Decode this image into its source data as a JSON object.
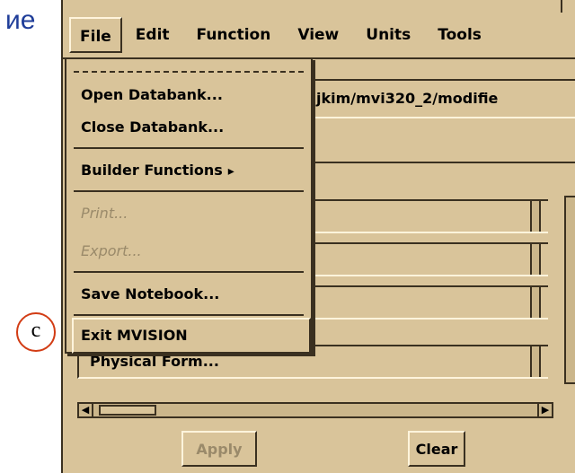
{
  "slide": {
    "text_fragment": "ие",
    "callout_label": "c"
  },
  "menubar": {
    "items": [
      {
        "label": "File",
        "active": true
      },
      {
        "label": "Edit"
      },
      {
        "label": "Function"
      },
      {
        "label": "View"
      },
      {
        "label": "Units"
      },
      {
        "label": "Tools"
      }
    ]
  },
  "path_field": {
    "value": "jkim/mvi320_2/modifie"
  },
  "file_menu": {
    "items": [
      {
        "label": "Open Databank...",
        "enabled": true
      },
      {
        "label": "Close Databank...",
        "enabled": true
      },
      {
        "label": "Builder Functions",
        "enabled": true,
        "cascade_icon": "cascade-arrow-icon"
      },
      {
        "label": "Print...",
        "enabled": false
      },
      {
        "label": "Export...",
        "enabled": false
      },
      {
        "label": "Save Notebook...",
        "enabled": true
      },
      {
        "label": "Exit MVISION",
        "enabled": true,
        "highlighted": true
      }
    ]
  },
  "form": {
    "visible_field_label": "Physical Form...",
    "apply_label": "Apply",
    "clear_label": "Clear"
  },
  "colors": {
    "panel": "#d9c49a",
    "shadow": "#3a3020",
    "highlight": "#fff4dc",
    "slide_text": "#1f3d99",
    "callout_border": "#d23c14"
  }
}
